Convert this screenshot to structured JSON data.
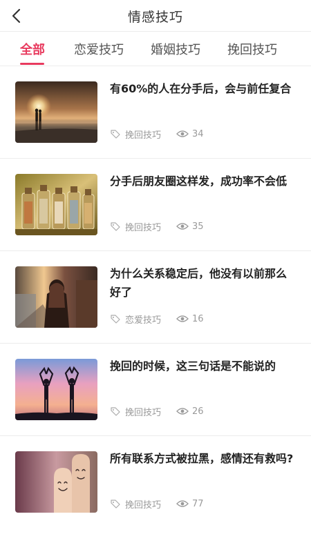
{
  "header": {
    "title": "情感技巧",
    "back_icon": "chevron-left-icon"
  },
  "tabs": [
    {
      "label": "全部",
      "active": true
    },
    {
      "label": "恋爱技巧",
      "active": false
    },
    {
      "label": "婚姻技巧",
      "active": false
    },
    {
      "label": "挽回技巧",
      "active": false
    }
  ],
  "colors": {
    "accent": "#e83a5e",
    "meta_text": "#9a9a9a",
    "divider": "#ececec"
  },
  "articles": [
    {
      "title": "有60%的人在分手后，会与前任复合",
      "tag": "挽回技巧",
      "views": "34",
      "image": "sunset-beach-couple"
    },
    {
      "title": "分手后朋友圈这样发，成功率不会低",
      "tag": "挽回技巧",
      "views": "35",
      "image": "message-bottles"
    },
    {
      "title": "为什么关系稳定后，他没有以前那么好了",
      "tag": "恋爱技巧",
      "views": "16",
      "image": "girl-on-street"
    },
    {
      "title": "挽回的时候，这三句话是不能说的",
      "tag": "挽回技巧",
      "views": "26",
      "image": "heart-silhouettes"
    },
    {
      "title": "所有联系方式被拉黑，感情还有救吗?",
      "tag": "挽回技巧",
      "views": "77",
      "image": "finger-faces"
    }
  ]
}
